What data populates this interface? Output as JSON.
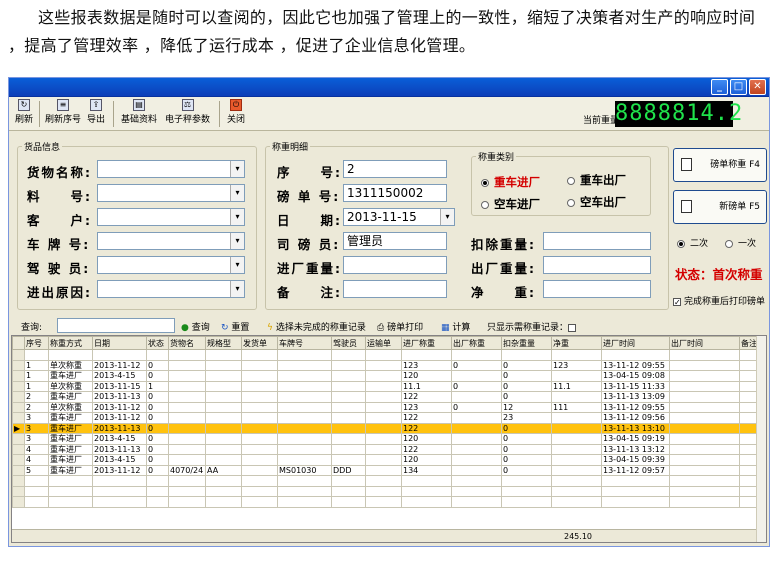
{
  "intro_text": "这些报表数据是随时可以查阅的，因此它也加强了管理上的一致性，缩短了决策者对生产的响应时间 ，提高了管理效率 ，降低了运行成本 ，促进了企业信息化管理。",
  "toolbar": {
    "refresh": "刷新",
    "refresh_serial": "刷新序号",
    "export": "导出",
    "base_data": "基础资料",
    "scale_params": "电子秤参数",
    "close": "关闭",
    "weight_label": "当前重量",
    "weight_value": "8888814.2"
  },
  "goods": {
    "legend": "货品信息",
    "name_label": "货物名称:",
    "material_label": "料　　号:",
    "customer_label": "客　　户:",
    "plate_label": "车 牌 号:",
    "driver_label": "驾 驶 员:",
    "reason_label": "进出原因:"
  },
  "detail": {
    "legend": "称重明细",
    "serial_label": "序　　号:",
    "serial_value": "2",
    "ticket_label": "磅 单 号:",
    "ticket_value": "1311150002",
    "date_label": "日　　期:",
    "date_value": "2013-11-15",
    "operator_label": "司 磅 员:",
    "operator_value": "管理员",
    "in_weight_label": "进厂重量:",
    "note_label": "备　　注:",
    "deduct_label": "扣除重量:",
    "out_weight_label": "出厂重量:",
    "net_label": "净　　重:",
    "type_legend": "称重类别",
    "heavy_in": "重车进厂",
    "heavy_out": "重车出厂",
    "empty_in": "空车进厂",
    "empty_out": "空车出厂"
  },
  "side": {
    "weigh_btn": "磅单称重 F4",
    "new_btn": "新磅单 F5",
    "twice": "二次",
    "once": "一次",
    "status": "状态：首次称重",
    "print_after": "完成称重后打印磅单"
  },
  "query": {
    "label": "查询:",
    "query_btn": "查询",
    "reset_btn": "重置",
    "select_unfinished": "选择未完成的称重记录",
    "print_ticket": "磅单打印",
    "calculate": "计算",
    "only_show": "只显示需称重记录："
  },
  "table": {
    "headers": [
      "序号",
      "称重方式",
      "日期",
      "状态",
      "货物名",
      "规格型",
      "发货单",
      "车牌号",
      "驾驶员",
      "运输单",
      "进厂称重",
      "出厂称重",
      "扣杂重量",
      "净重",
      "进厂时间",
      "出厂时间",
      "备注"
    ],
    "rows": [
      [
        "1",
        "单次称重",
        "2013-11-12",
        "0",
        "",
        "",
        "",
        "",
        "",
        "",
        "123",
        "0",
        "0",
        "123",
        "13-11-12 09:55",
        "",
        ""
      ],
      [
        "1",
        "重车进厂",
        "2013-4-15",
        "0",
        "",
        "",
        "",
        "",
        "",
        "",
        "120",
        "",
        "0",
        "",
        "13-04-15 09:08",
        "",
        ""
      ],
      [
        "1",
        "单次称重",
        "2013-11-15",
        "1",
        "",
        "",
        "",
        "",
        "",
        "",
        "11.1",
        "0",
        "0",
        "11.1",
        "13-11-15 11:33",
        "",
        ""
      ],
      [
        "2",
        "重车进厂",
        "2013-11-13",
        "0",
        "",
        "",
        "",
        "",
        "",
        "",
        "122",
        "",
        "0",
        "",
        "13-11-13 13:09",
        "",
        ""
      ],
      [
        "2",
        "单次称重",
        "2013-11-12",
        "0",
        "",
        "",
        "",
        "",
        "",
        "",
        "123",
        "0",
        "12",
        "111",
        "13-11-12 09:55",
        "",
        ""
      ],
      [
        "3",
        "重车进厂",
        "2013-11-12",
        "0",
        "",
        "",
        "",
        "",
        "",
        "",
        "122",
        "",
        "23",
        "",
        "13-11-12 09:56",
        "",
        ""
      ],
      [
        "3",
        "重车进厂",
        "2013-11-13",
        "0",
        "",
        "",
        "",
        "",
        "",
        "",
        "122",
        "",
        "0",
        "",
        "13-11-13 13:10",
        "",
        ""
      ],
      [
        "3",
        "重车进厂",
        "2013-4-15",
        "0",
        "",
        "",
        "",
        "",
        "",
        "",
        "120",
        "",
        "0",
        "",
        "13-04-15 09:19",
        "",
        ""
      ],
      [
        "4",
        "重车进厂",
        "2013-11-13",
        "0",
        "",
        "",
        "",
        "",
        "",
        "",
        "122",
        "",
        "0",
        "",
        "13-11-13 13:12",
        "",
        ""
      ],
      [
        "4",
        "重车进厂",
        "2013-4-15",
        "0",
        "",
        "",
        "",
        "",
        "",
        "",
        "120",
        "",
        "0",
        "",
        "13-04-15 09:39",
        "",
        ""
      ],
      [
        "5",
        "重车进厂",
        "2013-11-12",
        "0",
        "4070/24",
        "AA",
        "",
        "MS01030",
        "DDD",
        "",
        "134",
        "",
        "0",
        "",
        "13-11-12 09:57",
        "",
        ""
      ]
    ],
    "total_net": "245.10"
  }
}
